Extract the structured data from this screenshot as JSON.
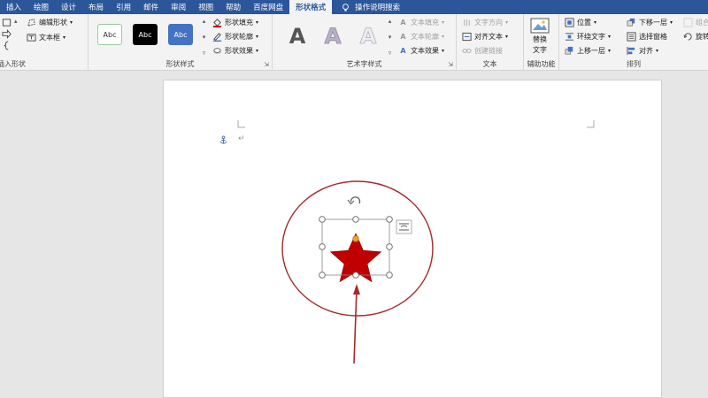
{
  "tabs": [
    "插入",
    "绘图",
    "设计",
    "布局",
    "引用",
    "邮件",
    "审阅",
    "视图",
    "帮助",
    "百度网盘",
    "形状格式"
  ],
  "active_tab_index": 10,
  "search_label": "操作说明搜索",
  "insert_shapes": {
    "label": "插入形状",
    "edit_shape": "编辑形状",
    "text_box": "文本框"
  },
  "shape_styles": {
    "label": "形状样式",
    "thumb_text": "Abc",
    "fill": "形状填充",
    "outline": "形状轮廓",
    "effects": "形状效果"
  },
  "wordart": {
    "label": "艺术字样式",
    "glyph": "A",
    "text_fill": "文本填充",
    "text_outline": "文本轮廓",
    "text_effects": "文本效果"
  },
  "text_group": {
    "label": "文本",
    "direction": "文字方向",
    "align": "对齐文本",
    "link": "创建链接"
  },
  "accessibility": {
    "label": "辅助功能",
    "alt_text_line1": "替换",
    "alt_text_line2": "文字"
  },
  "arrange": {
    "label": "排列",
    "position": "位置",
    "wrap": "环绕文字",
    "bring_forward": "上移一层",
    "send_backward": "下移一层",
    "selection_pane": "选择窗格",
    "align": "对齐",
    "group": "组合",
    "rotate": "旋转"
  },
  "colors": {
    "tab_bar": "#2b579a",
    "star_fill": "#c00000",
    "circle_stroke": "#a52a2a",
    "arrow": "#a52a2a",
    "thumb_blue": "#4472c4"
  }
}
